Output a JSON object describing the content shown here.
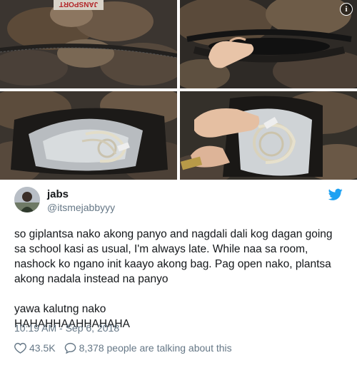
{
  "media": {
    "photos": [
      "photo-backpack-top",
      "photo-hand-opening-bag",
      "photo-iron-in-bag",
      "photo-hand-holding-iron-cord"
    ],
    "bag_brand_text": "JANSPORT",
    "info_icon": "info-icon"
  },
  "author": {
    "name": "jabs",
    "handle": "@itsmejabbyyy",
    "brand_icon": "twitter-bird-icon"
  },
  "tweet": {
    "paragraph1": "so giplantsa nako akong panyo and nagdali dali kog dagan going sa school kasi as usual, I'm always late. While naa sa room, nashock ko ngano init kaayo akong bag. Pag open nako, plantsa akong nadala instead na panyo",
    "paragraph2": "yawa kalutng nako HAHAHHAAHHAHAHA",
    "timestamp": "10:19 AM - Sep 6, 2018"
  },
  "actions": {
    "likes": "43.5K",
    "replies_text": "8,378 people are talking about this"
  },
  "colors": {
    "text": "#14171a",
    "secondary": "#657786",
    "twitter_blue": "#1da1f2"
  }
}
